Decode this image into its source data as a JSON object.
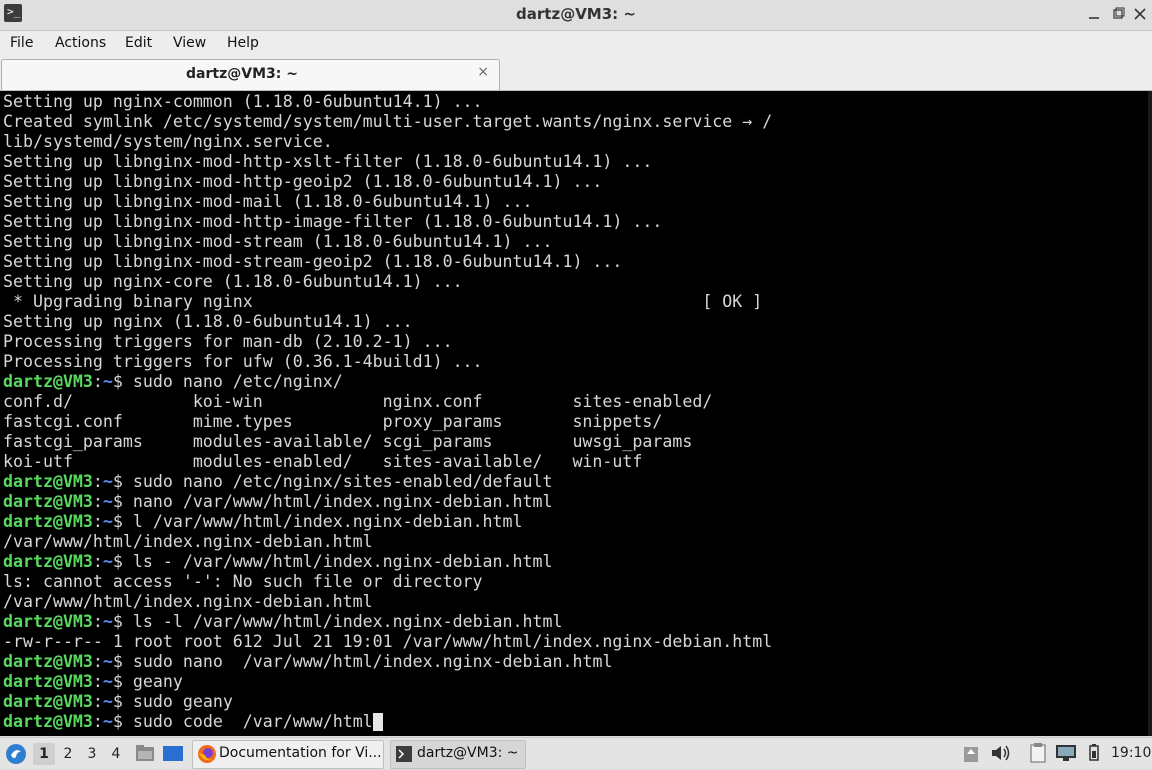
{
  "window": {
    "title": "dartz@VM3: ~",
    "controls": [
      "minimize",
      "maximize",
      "close"
    ]
  },
  "menu": {
    "items": [
      "File",
      "Actions",
      "Edit",
      "View",
      "Help"
    ]
  },
  "tabs": [
    {
      "label": "dartz@VM3: ~",
      "close_glyph": "×"
    }
  ],
  "terminal": {
    "lines": [
      "Setting up nginx-common (1.18.0-6ubuntu14.1) ...",
      "Created symlink /etc/systemd/system/multi-user.target.wants/nginx.service → /",
      "lib/systemd/system/nginx.service.",
      "Setting up libnginx-mod-http-xslt-filter (1.18.0-6ubuntu14.1) ...",
      "Setting up libnginx-mod-http-geoip2 (1.18.0-6ubuntu14.1) ...",
      "Setting up libnginx-mod-mail (1.18.0-6ubuntu14.1) ...",
      "Setting up libnginx-mod-http-image-filter (1.18.0-6ubuntu14.1) ...",
      "Setting up libnginx-mod-stream (1.18.0-6ubuntu14.1) ...",
      "Setting up libnginx-mod-stream-geoip2 (1.18.0-6ubuntu14.1) ...",
      "Setting up nginx-core (1.18.0-6ubuntu14.1) ...",
      " * Upgrading binary nginx                                             [ OK ]",
      "Setting up nginx (1.18.0-6ubuntu14.1) ...",
      "Processing triggers for man-db (2.10.2-1) ...",
      "Processing triggers for ufw (0.36.1-4build1) ...",
      "$ sudo nano /etc/nginx/",
      "conf.d/            koi-win            nginx.conf         sites-enabled/",
      "fastcgi.conf       mime.types         proxy_params       snippets/",
      "fastcgi_params     modules-available/ scgi_params        uwsgi_params",
      "koi-utf            modules-enabled/   sites-available/   win-utf",
      "$ sudo nano /etc/nginx/sites-enabled/default",
      "$ nano /var/www/html/index.nginx-debian.html",
      "$ l /var/www/html/index.nginx-debian.html",
      "/var/www/html/index.nginx-debian.html",
      "$ ls - /var/www/html/index.nginx-debian.html",
      "ls: cannot access '-': No such file or directory",
      "/var/www/html/index.nginx-debian.html",
      "$ ls -l /var/www/html/index.nginx-debian.html",
      "-rw-r--r-- 1 root root 612 Jul 21 19:01 /var/www/html/index.nginx-debian.html",
      "$ sudo nano  /var/www/html/index.nginx-debian.html",
      "$ geany",
      "$ sudo geany",
      "$ sudo code  /var/www/html"
    ],
    "prompt_user": "dartz@VM3",
    "prompt_colon": ":",
    "prompt_path": "~",
    "colors": {
      "background": "#000000",
      "text": "#d7d7d7",
      "prompt_user": "#58d95f",
      "prompt_path": "#5c8cff"
    }
  },
  "taskbar": {
    "workspaces": [
      "1",
      "2",
      "3",
      "4"
    ],
    "active_workspace": "1",
    "tasks": [
      {
        "label": "Documentation for Vi...",
        "icon": "firefox-icon"
      },
      {
        "label": "dartz@VM3: ~",
        "icon": "terminal-icon"
      }
    ],
    "clock": "19:10"
  }
}
